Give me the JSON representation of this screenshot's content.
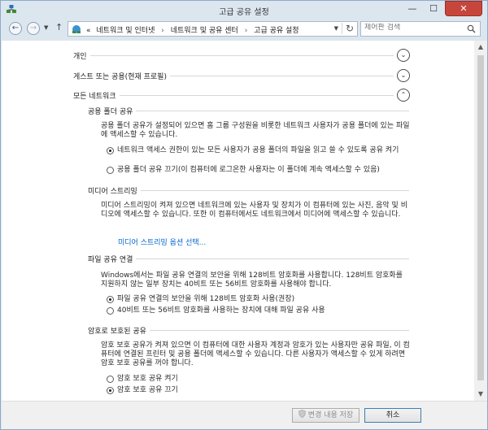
{
  "window": {
    "title": "고급 공유 설정",
    "min_glyph": "—",
    "max_glyph": "☐",
    "close_glyph": "✕"
  },
  "address": {
    "back_glyph": "←",
    "forward_glyph": "→",
    "dropdown_glyph": "▼",
    "up_glyph": "↑",
    "prefix": "«",
    "crumbs": [
      "네트워크 및 인터넷",
      "네트워크 및 공유 센터",
      "고급 공유 설정"
    ],
    "crumb_sep": "›",
    "refresh_glyph": "↻",
    "search_placeholder": "제어판 검색"
  },
  "sections": {
    "private": {
      "label": "개인",
      "chevron": "⌄"
    },
    "guest": {
      "label": "게스트 또는 공용(현재 프로필)",
      "chevron": "⌄"
    },
    "all": {
      "label": "모든 네트워크",
      "chevron": "⌃"
    }
  },
  "public_folder": {
    "heading": "공용 폴더 공유",
    "description": "공용 폴더 공유가 설정되어 있으면 홈 그룹 구성원을 비롯한 네트워크 사용자가 공용 폴더에 있는 파일에 액세스할 수 있습니다.",
    "option_on": "네트워크 액세스 권한이 있는 모든 사용자가 공용 폴더의 파일을 읽고 쓸 수 있도록 공유 켜기",
    "option_off": "공용 폴더 공유 끄기(이 컴퓨터에 로그온한 사용자는 이 폴더에 계속 액세스할 수 있음)",
    "selected": "on"
  },
  "media": {
    "heading": "미디어 스트리밍",
    "description": "미디어 스트리밍이 켜져 있으면 네트워크에 있는 사용자 및 장치가 이 컴퓨터에 있는 사진, 음악 및 비디오에 액세스할 수 있습니다. 또한 이 컴퓨터에서도 네트워크에서 미디어에 액세스할 수 있습니다.",
    "link": "미디어 스트리밍 옵션 선택..."
  },
  "file_sharing": {
    "heading": "파일 공유 연결",
    "description": "Windows에서는 파일 공유 연결의 보안을 위해 128비트 암호화를 사용합니다. 128비트 암호화를 지원하지 않는 일부 장치는 40비트 또는 56비트 암호화를 사용해야 합니다.",
    "option_128": "파일 공유 연결의 보안을 위해 128비트 암호화 사용(권장)",
    "option_40": "40비트 또는 56비트 암호화를 사용하는 장치에 대해 파일 공유 사용",
    "selected": "128"
  },
  "password": {
    "heading": "암호로 보호된 공유",
    "description": "암호 보호 공유가 켜져 있으면 이 컴퓨터에 대한 사용자 계정과 암호가 있는 사용자만 공유 파일, 이 컴퓨터에 연결된 프린터 및 공용 폴더에 액세스할 수 있습니다. 다른 사용자가 액세스할 수 있게 하려면 암호 보호 공유를 꺼야 합니다.",
    "option_on": "암호 보호 공유 켜기",
    "option_off": "암호 보호 공유 끄기",
    "selected": "off"
  },
  "footer": {
    "save_label": "변경 내용 저장",
    "cancel_label": "취소"
  },
  "scrollbar": {
    "up_glyph": "▲",
    "down_glyph": "▼"
  },
  "colors": {
    "link": "#0066cc",
    "close": "#c7463c",
    "frame": "#dce6ef"
  }
}
